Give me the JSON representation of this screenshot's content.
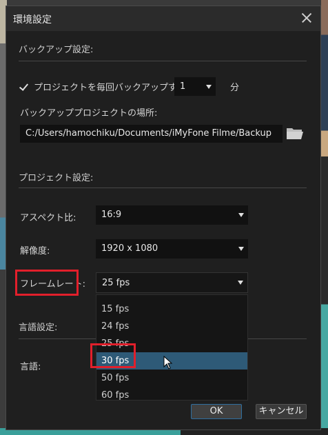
{
  "dialog": {
    "title": "環境設定"
  },
  "backup": {
    "section_label": "バックアップ設定:",
    "auto_backup_label": "プロジェクトを毎回バックアップする",
    "interval_value": "1",
    "interval_unit": "分",
    "location_label": "バックアッププロジェクトの場所:",
    "location_path": "C:/Users/hamochiku/Documents/iMyFone Filme/Backup"
  },
  "project": {
    "section_label": "プロジェクト設定:",
    "aspect_label": "アスペクト比:",
    "aspect_value": "16:9",
    "resolution_label": "解像度:",
    "resolution_value": "1920 x 1080",
    "framerate_label": "フレームレート:",
    "framerate_value": "25 fps",
    "framerate_options": [
      "15 fps",
      "24 fps",
      "25 fps",
      "30 fps",
      "50 fps",
      "60 fps"
    ]
  },
  "language": {
    "section_label": "言語設定:",
    "language_label": "言語:"
  },
  "buttons": {
    "ok": "OK",
    "cancel": "キャンセル"
  },
  "colors": {
    "highlight": "#e21f2b",
    "selection": "#2e5a77"
  }
}
